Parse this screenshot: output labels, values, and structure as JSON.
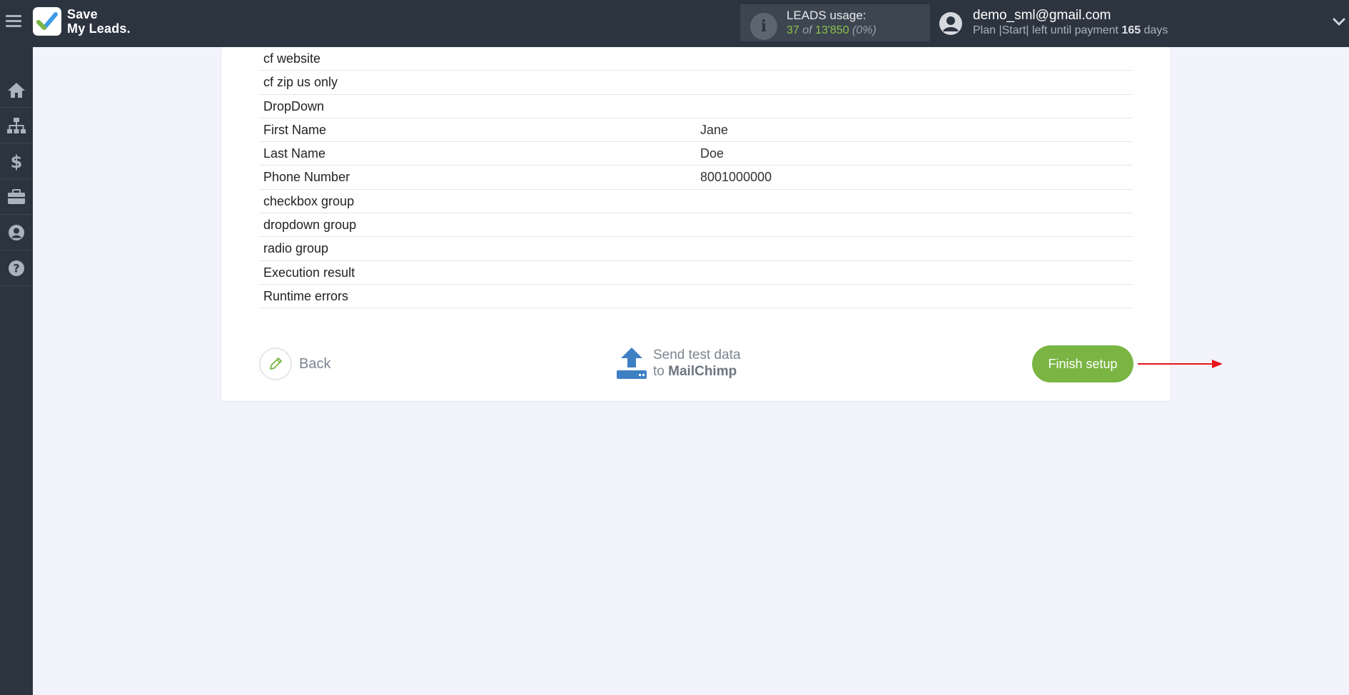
{
  "app": {
    "logo_line1": "Save",
    "logo_line2": "My Leads."
  },
  "usage": {
    "label": "LEADS usage:",
    "used": "37",
    "of": "of",
    "total": "13'850",
    "percent": "(0%)"
  },
  "account": {
    "email": "demo_sml@gmail.com",
    "plan_text": "Plan |Start| left until payment",
    "days": "165",
    "days_suffix": "days"
  },
  "sidebar": {
    "items": [
      {
        "name": "home-icon"
      },
      {
        "name": "sitemap-icon"
      },
      {
        "name": "dollar-icon"
      },
      {
        "name": "briefcase-icon"
      },
      {
        "name": "user-icon"
      },
      {
        "name": "help-icon"
      }
    ]
  },
  "fields": [
    {
      "name": "cf website",
      "value": ""
    },
    {
      "name": "cf zip us only",
      "value": ""
    },
    {
      "name": "DropDown",
      "value": ""
    },
    {
      "name": "First Name",
      "value": "Jane"
    },
    {
      "name": "Last Name",
      "value": "Doe"
    },
    {
      "name": "Phone Number",
      "value": "8001000000"
    },
    {
      "name": "checkbox group",
      "value": ""
    },
    {
      "name": "dropdown group",
      "value": ""
    },
    {
      "name": "radio group",
      "value": ""
    },
    {
      "name": "Execution result",
      "value": ""
    },
    {
      "name": "Runtime errors",
      "value": ""
    }
  ],
  "actions": {
    "back_label": "Back",
    "send_line1": "Send test data",
    "send_line2_prefix": "to",
    "send_line2_target": "MailChimp",
    "finish_label": "Finish setup"
  },
  "colors": {
    "topbar": "#2c3440",
    "accent_green": "#7ab543",
    "arrow_red": "#e8141c",
    "send_blue": "#3f7fc4"
  }
}
